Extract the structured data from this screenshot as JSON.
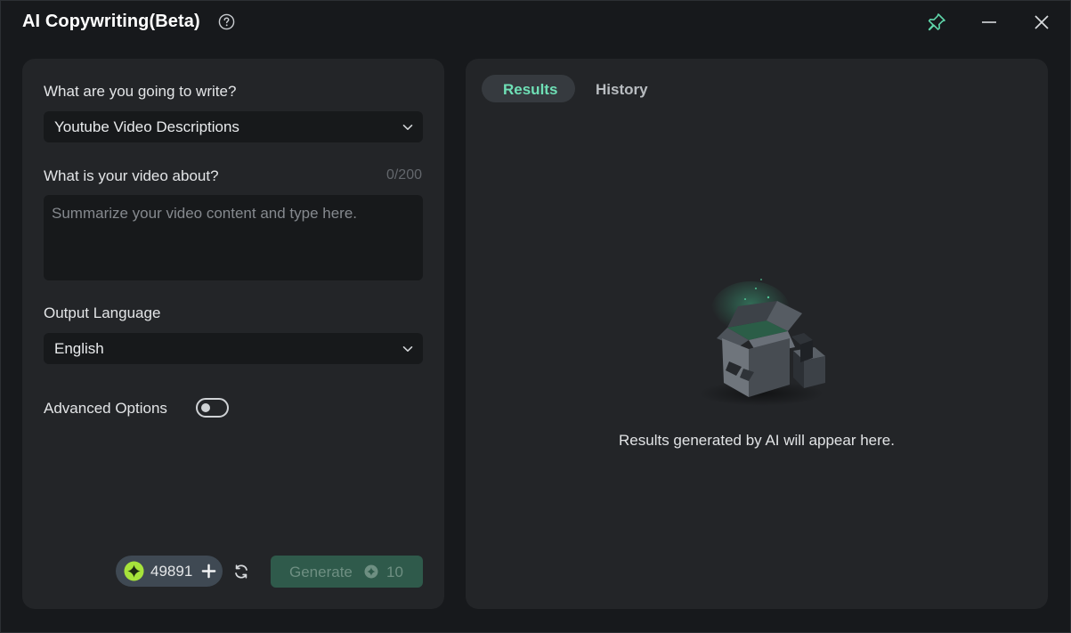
{
  "window": {
    "title": "AI Copywriting(Beta)"
  },
  "form": {
    "write_label": "What are you going to write?",
    "write_type_value": "Youtube Video Descriptions",
    "about_label": "What is your video about?",
    "char_counter": "0/200",
    "about_placeholder": "Summarize your video content and type here.",
    "language_label": "Output Language",
    "language_value": "English",
    "advanced_label": "Advanced Options",
    "advanced_enabled": false
  },
  "footer": {
    "credits_value": "49891",
    "generate_label": "Generate",
    "generate_cost": "10"
  },
  "results": {
    "tabs": [
      {
        "label": "Results",
        "active": true
      },
      {
        "label": "History",
        "active": false
      }
    ],
    "empty_message": "Results generated by AI will appear here."
  },
  "colors": {
    "accent": "#6fe0b6",
    "panel": "#232528",
    "input_bg": "#17191b",
    "generate_bg": "#2f5a4b"
  },
  "icons": [
    "help-icon",
    "pin-icon",
    "minimize-icon",
    "close-icon",
    "chevron-down-icon",
    "ai-credit-icon",
    "plus-icon",
    "refresh-icon",
    "coin-icon",
    "empty-box-icon"
  ]
}
